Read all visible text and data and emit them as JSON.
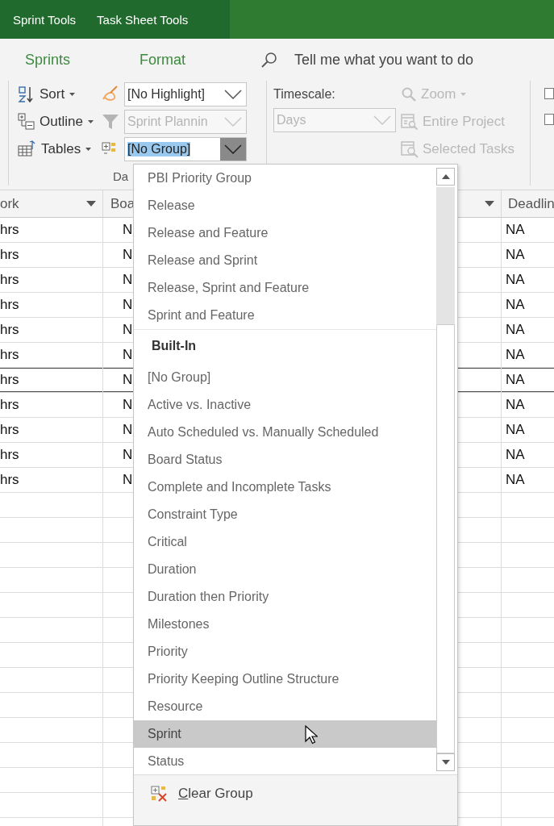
{
  "context_tabs": [
    "Sprint Tools",
    "Task Sheet Tools"
  ],
  "ribbon_tabs": [
    "Sprints",
    "Format"
  ],
  "tell_me": {
    "placeholder": "Tell me what you want to do"
  },
  "view_buttons": [
    {
      "label": "Sort"
    },
    {
      "label": "Outline"
    },
    {
      "label": "Tables"
    }
  ],
  "data_group": {
    "label": "Da",
    "combos": [
      {
        "value": "[No Highlight]",
        "disabled": false,
        "open": false
      },
      {
        "value": "Sprint Plannin",
        "disabled": true,
        "open": false
      },
      {
        "value": "[No Group]",
        "disabled": false,
        "open": true
      }
    ]
  },
  "timescale_group": {
    "label": "Timescale:",
    "timescale": {
      "value": "Days",
      "disabled": true
    },
    "buttons": [
      {
        "label": "Zoom",
        "disabled": true,
        "has_menu": true
      },
      {
        "label": "Entire Project",
        "disabled": true,
        "has_menu": false
      },
      {
        "label": "Selected Tasks",
        "disabled": true,
        "has_menu": false
      }
    ]
  },
  "checkboxes": [
    {
      "checked": false
    },
    {
      "checked": false
    }
  ],
  "table": {
    "columns": [
      {
        "label": "ork",
        "filter_arrow": true
      },
      {
        "label": "Boa",
        "filter_arrow": true
      },
      {
        "label": "Deadlin"
      }
    ],
    "rows": [
      {
        "cells": [
          "hrs",
          "N",
          "NA"
        ],
        "selected": false
      },
      {
        "cells": [
          "hrs",
          "N",
          "NA"
        ],
        "selected": false
      },
      {
        "cells": [
          "hrs",
          "N",
          "NA"
        ],
        "selected": false
      },
      {
        "cells": [
          "hrs",
          "N",
          "NA"
        ],
        "selected": false
      },
      {
        "cells": [
          "hrs",
          "N",
          "NA"
        ],
        "selected": false
      },
      {
        "cells": [
          "hrs",
          "N",
          "NA"
        ],
        "selected": false
      },
      {
        "cells": [
          "hrs",
          "N",
          "NA"
        ],
        "selected": true
      },
      {
        "cells": [
          "hrs",
          "N",
          "NA"
        ],
        "selected": false
      },
      {
        "cells": [
          "hrs",
          "N",
          "NA"
        ],
        "selected": false
      },
      {
        "cells": [
          "hrs",
          "N",
          "NA"
        ],
        "selected": false
      },
      {
        "cells": [
          "hrs",
          "N",
          "NA"
        ],
        "selected": false
      }
    ]
  },
  "group_menu": {
    "items": [
      {
        "kind": "item",
        "label": "PBI Priority Group",
        "hovered": false
      },
      {
        "kind": "item",
        "label": "Release",
        "hovered": false
      },
      {
        "kind": "item",
        "label": "Release and Feature",
        "hovered": false
      },
      {
        "kind": "item",
        "label": "Release and Sprint",
        "hovered": false
      },
      {
        "kind": "item",
        "label": "Release, Sprint and Feature",
        "hovered": false
      },
      {
        "kind": "item",
        "label": "Sprint and Feature",
        "hovered": false
      },
      {
        "kind": "header",
        "label": "Built-In"
      },
      {
        "kind": "item",
        "label": "[No Group]",
        "hovered": false
      },
      {
        "kind": "item",
        "label": "Active vs. Inactive",
        "hovered": false
      },
      {
        "kind": "item",
        "label": "Auto Scheduled vs. Manually Scheduled",
        "hovered": false
      },
      {
        "kind": "item",
        "label": "Board Status",
        "hovered": false
      },
      {
        "kind": "item",
        "label": "Complete and Incomplete Tasks",
        "hovered": false
      },
      {
        "kind": "item",
        "label": "Constraint Type",
        "hovered": false
      },
      {
        "kind": "item",
        "label": "Critical",
        "hovered": false
      },
      {
        "kind": "item",
        "label": "Duration",
        "hovered": false
      },
      {
        "kind": "item",
        "label": "Duration then Priority",
        "hovered": false
      },
      {
        "kind": "item",
        "label": "Milestones",
        "hovered": false
      },
      {
        "kind": "item",
        "label": "Priority",
        "hovered": false
      },
      {
        "kind": "item",
        "label": "Priority Keeping Outline Structure",
        "hovered": false
      },
      {
        "kind": "item",
        "label": "Resource",
        "hovered": false
      },
      {
        "kind": "item",
        "label": "Sprint",
        "hovered": true
      },
      {
        "kind": "item",
        "label": "Status",
        "hovered": false
      }
    ],
    "actions": [
      {
        "label": "Clear Group"
      }
    ]
  }
}
